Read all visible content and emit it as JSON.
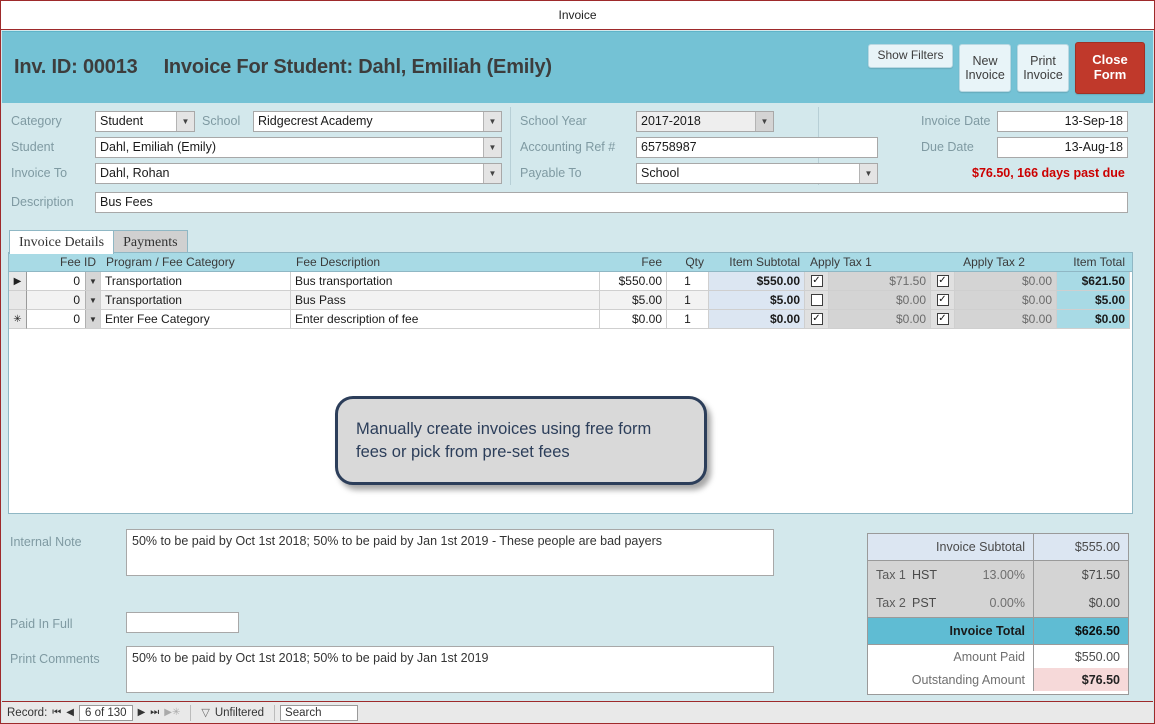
{
  "window": {
    "title": "Invoice"
  },
  "header": {
    "inv_id_label": "Inv. ID: 00013",
    "title": "Invoice For Student: Dahl, Emiliah (Emily)",
    "buttons": {
      "show_filters": "Show Filters",
      "new_invoice": "New Invoice",
      "print_invoice": "Print Invoice",
      "close_form": "Close Form"
    },
    "accent_color": "#74c2d5",
    "close_color": "#c0392b"
  },
  "form": {
    "left": {
      "category_label": "Category",
      "category_value": "Student",
      "school_label": "School",
      "school_value": "Ridgecrest Academy",
      "student_label": "Student",
      "student_value": "Dahl, Emiliah (Emily)",
      "invoice_to_label": "Invoice To",
      "invoice_to_value": "Dahl, Rohan"
    },
    "middle": {
      "school_year_label": "School Year",
      "school_year_value": "2017-2018",
      "accounting_ref_label": "Accounting Ref  #",
      "accounting_ref_value": "65758987",
      "payable_to_label": "Payable To",
      "payable_to_value": "School"
    },
    "right": {
      "invoice_date_label": "Invoice Date",
      "invoice_date_value": "13-Sep-18",
      "due_date_label": "Due Date",
      "due_date_value": "13-Aug-18",
      "past_due_text": "$76.50, 166 days past due",
      "past_due_color": "#cc0000"
    },
    "description_label": "Description",
    "description_value": "Bus  Fees"
  },
  "tabs": [
    {
      "label": "Invoice Details",
      "active": true
    },
    {
      "label": "Payments",
      "active": false
    }
  ],
  "grid": {
    "columns": [
      "Fee ID",
      "Program / Fee Category",
      "Fee Description",
      "Fee",
      "Qty",
      "Item Subtotal",
      "Apply Tax 1",
      "Apply Tax 2",
      "Item Total"
    ],
    "rows": [
      {
        "selector": "current",
        "fee_id": "0",
        "category": "Transportation",
        "description": "Bus transportation",
        "fee": "$550.00",
        "qty": "1",
        "subtotal": "$550.00",
        "tax1_checked": true,
        "tax1_amount": "$71.50",
        "tax2_checked": true,
        "tax2_amount": "$0.00",
        "item_total": "$621.50"
      },
      {
        "selector": "",
        "fee_id": "0",
        "category": "Transportation",
        "description": "Bus Pass",
        "fee": "$5.00",
        "qty": "1",
        "subtotal": "$5.00",
        "tax1_checked": false,
        "tax1_amount": "$0.00",
        "tax2_checked": true,
        "tax2_amount": "$0.00",
        "item_total": "$5.00"
      },
      {
        "selector": "new",
        "fee_id": "0",
        "category": "Enter Fee Category",
        "description": "Enter description of fee",
        "fee": "$0.00",
        "qty": "1",
        "subtotal": "$0.00",
        "tax1_checked": true,
        "tax1_amount": "$0.00",
        "tax2_checked": true,
        "tax2_amount": "$0.00",
        "item_total": "$0.00"
      }
    ]
  },
  "callout": {
    "text": "Manually create invoices using free form fees or pick from pre-set fees"
  },
  "notes": {
    "internal_note_label": "Internal Note",
    "internal_note_value": "50% to be paid by Oct 1st 2018; 50% to be paid by Jan 1st 2019 - These people are bad payers",
    "paid_in_full_label": "Paid In Full",
    "paid_in_full_value": "",
    "print_comments_label": "Print Comments",
    "print_comments_value": "50% to be paid by Oct 1st 2018; 50% to be paid by Jan 1st 2019"
  },
  "totals": {
    "subtotal_label": "Invoice Subtotal",
    "subtotal_value": "$555.00",
    "tax1_label": "Tax 1",
    "tax1_name": "HST",
    "tax1_rate": "13.00%",
    "tax1_value": "$71.50",
    "tax2_label": "Tax 2",
    "tax2_name": "PST",
    "tax2_rate": "0.00%",
    "tax2_value": "$0.00",
    "total_label": "Invoice Total",
    "total_value": "$626.50",
    "paid_label": "Amount Paid",
    "paid_value": "$550.00",
    "outstanding_label": "Outstanding Amount",
    "outstanding_value": "$76.50"
  },
  "statusbar": {
    "record_label": "Record:",
    "record_position": "6 of 130",
    "filter_label": "Unfiltered",
    "search_value": "Search"
  }
}
